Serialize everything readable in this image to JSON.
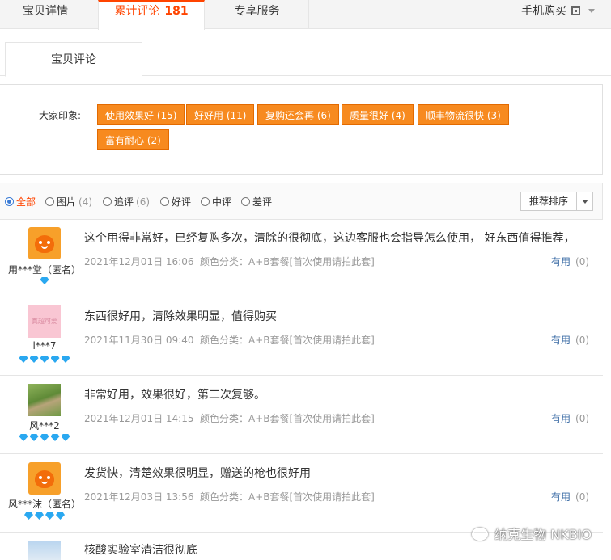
{
  "top_tabs": {
    "details": "宝贝详情",
    "reviews": "累计评论",
    "reviews_count": "181",
    "service": "专享服务",
    "mobile_buy": "手机购买"
  },
  "sub_tab": "宝贝评论",
  "impressions": {
    "label": "大家印象:",
    "tags": [
      "使用效果好 (15)",
      "好好用 (11)",
      "复购还会再 (6)",
      "质量很好 (4)",
      "顺丰物流很快 (3)",
      "富有耐心 (2)"
    ]
  },
  "filters": [
    {
      "label": "全部",
      "count": ""
    },
    {
      "label": "图片",
      "count": "(4)"
    },
    {
      "label": "追评",
      "count": "(6)"
    },
    {
      "label": "好评",
      "count": ""
    },
    {
      "label": "中评",
      "count": ""
    },
    {
      "label": "差评",
      "count": ""
    }
  ],
  "sort": "推荐排序",
  "reviews": [
    {
      "avatar": "orange-mascot",
      "nick": "用***堂（匿名）",
      "gems": 1,
      "content": "这个用得非常好，已经复购多次，清除的很彻底，这边客服也会指导怎么使用， 好东西值得推荐，",
      "date": "2021年12月01日 16:06",
      "spec": "颜色分类：A+B套餐[首次使用请拍此套]",
      "useful": "有用",
      "useful_count": "(0)"
    },
    {
      "avatar": "pink",
      "avatar_text": "真超可爱",
      "nick": "l***7",
      "gems": 5,
      "content": "东西很好用，清除效果明显，值得购买",
      "date": "2021年11月30日 09:40",
      "spec": "颜色分类：A+B套餐[首次使用请拍此套]",
      "useful": "有用",
      "useful_count": "(0)"
    },
    {
      "avatar": "green-landscape",
      "nick": "风***2",
      "gems": 5,
      "content": "非常好用，效果很好，第二次复够。",
      "date": "2021年12月01日 14:15",
      "spec": "颜色分类：A+B套餐[首次使用请拍此套]",
      "useful": "有用",
      "useful_count": "(0)"
    },
    {
      "avatar": "orange-mascot",
      "nick": "风***沫（匿名）",
      "gems": 4,
      "content": "发货快，清楚效果很明显，赠送的枪也很好用",
      "date": "2021年12月03日 13:56",
      "spec": "颜色分类：A+B套餐[首次使用请拍此套]",
      "useful": "有用",
      "useful_count": "(0)"
    },
    {
      "avatar": "sky",
      "content": "核酸实验室清洁很彻底"
    }
  ],
  "watermark": "纳克生物 NKBIO"
}
